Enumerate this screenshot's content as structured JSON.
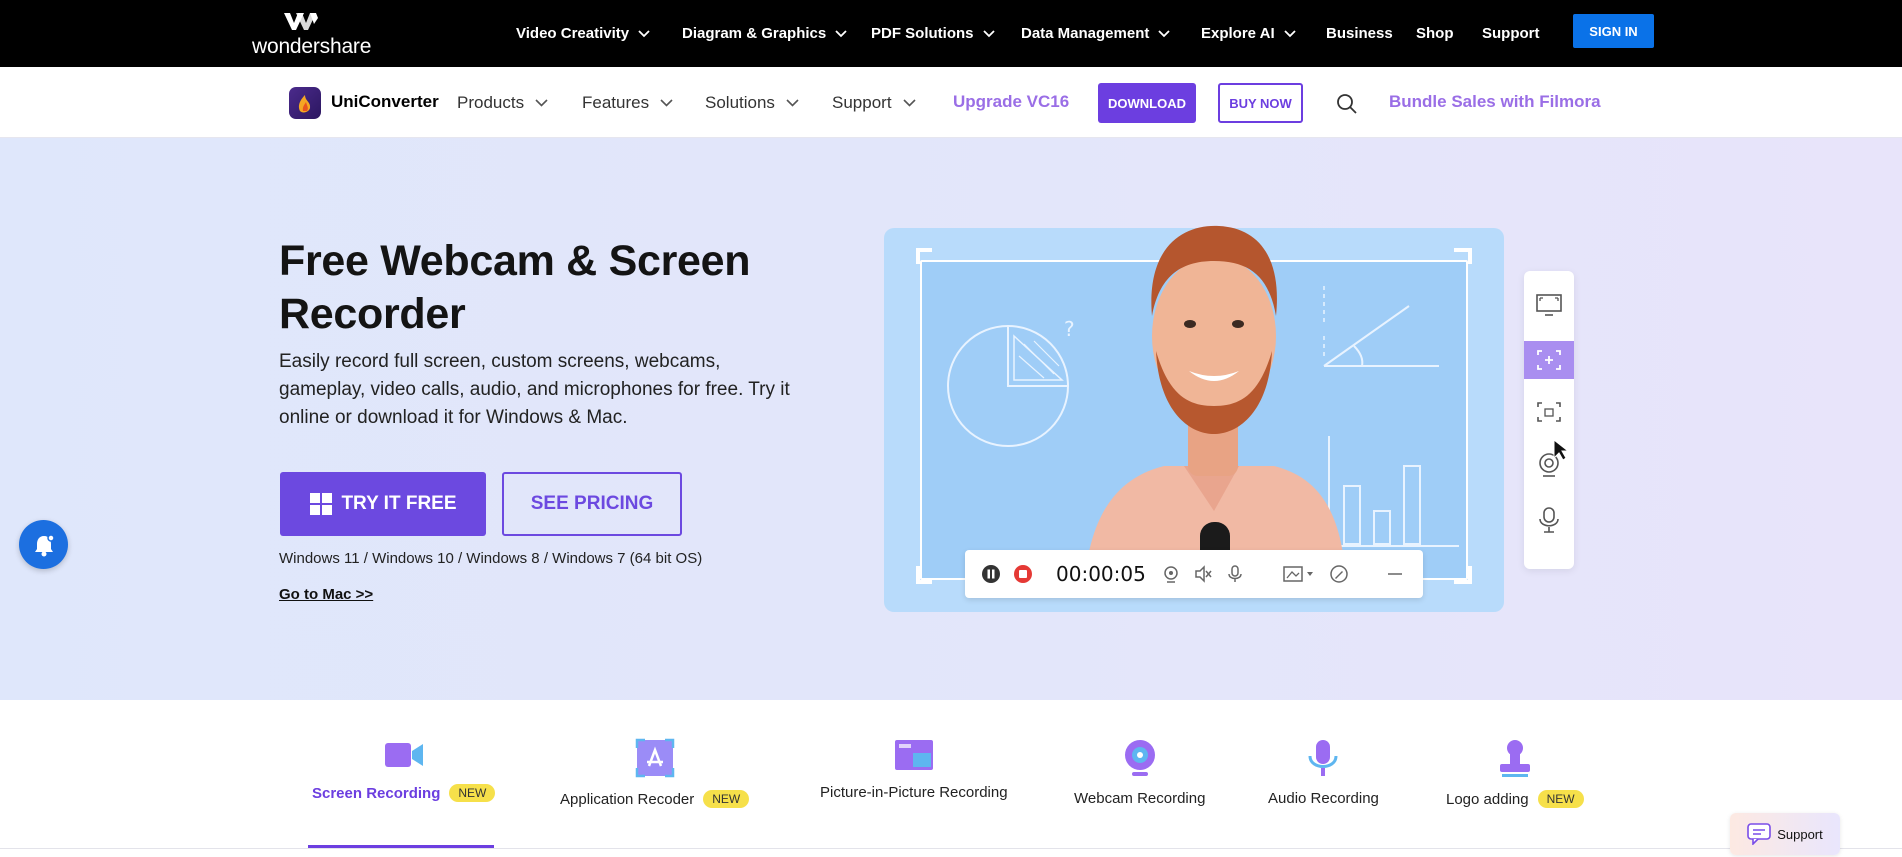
{
  "topbar": {
    "logo_text": "wondershare",
    "nav": [
      {
        "label": "Video Creativity"
      },
      {
        "label": "Diagram & Graphics"
      },
      {
        "label": "PDF Solutions"
      },
      {
        "label": "Data Management"
      },
      {
        "label": "Explore AI"
      }
    ],
    "links": {
      "business": "Business",
      "shop": "Shop",
      "support": "Support"
    },
    "signin": "SIGN IN"
  },
  "productbar": {
    "name": "UniConverter",
    "nav": [
      {
        "label": "Products"
      },
      {
        "label": "Features"
      },
      {
        "label": "Solutions"
      },
      {
        "label": "Support"
      }
    ],
    "upgrade": "Upgrade VC16",
    "download": "DOWNLOAD",
    "buy": "BUY NOW",
    "bundle": "Bundle Sales with Filmora"
  },
  "hero": {
    "title": "Free Webcam & Screen Recorder",
    "subtitle": "Easily record full screen, custom screens, webcams, gameplay, video calls, audio, and microphones for free. Try it online or download it for Windows & Mac.",
    "try_label": "TRY IT FREE",
    "pricing_label": "SEE PRICING",
    "os": "Windows 11 / Windows 10 / Windows 8 / Windows 7 (64 bit OS)",
    "mac_link": "Go to Mac >>",
    "recorder_time": "00:00:05"
  },
  "tabs": [
    {
      "label": "Screen Recording",
      "badge": "NEW",
      "icon": "video-camera-icon"
    },
    {
      "label": "Application Recoder",
      "badge": "NEW",
      "icon": "app-store-icon"
    },
    {
      "label": "Picture-in-Picture Recording",
      "badge": "",
      "icon": "picture-in-picture-icon"
    },
    {
      "label": "Webcam Recording",
      "badge": "",
      "icon": "webcam-icon"
    },
    {
      "label": "Audio Recording",
      "badge": "",
      "icon": "microphone-icon"
    },
    {
      "label": "Logo adding",
      "badge": "NEW",
      "icon": "stamp-icon"
    }
  ],
  "support_chip": "Support",
  "colors": {
    "accent": "#6c3ee0",
    "signin": "#0a72e8",
    "badge": "#f6e04a",
    "hero_bg": "#e1e6fb"
  }
}
